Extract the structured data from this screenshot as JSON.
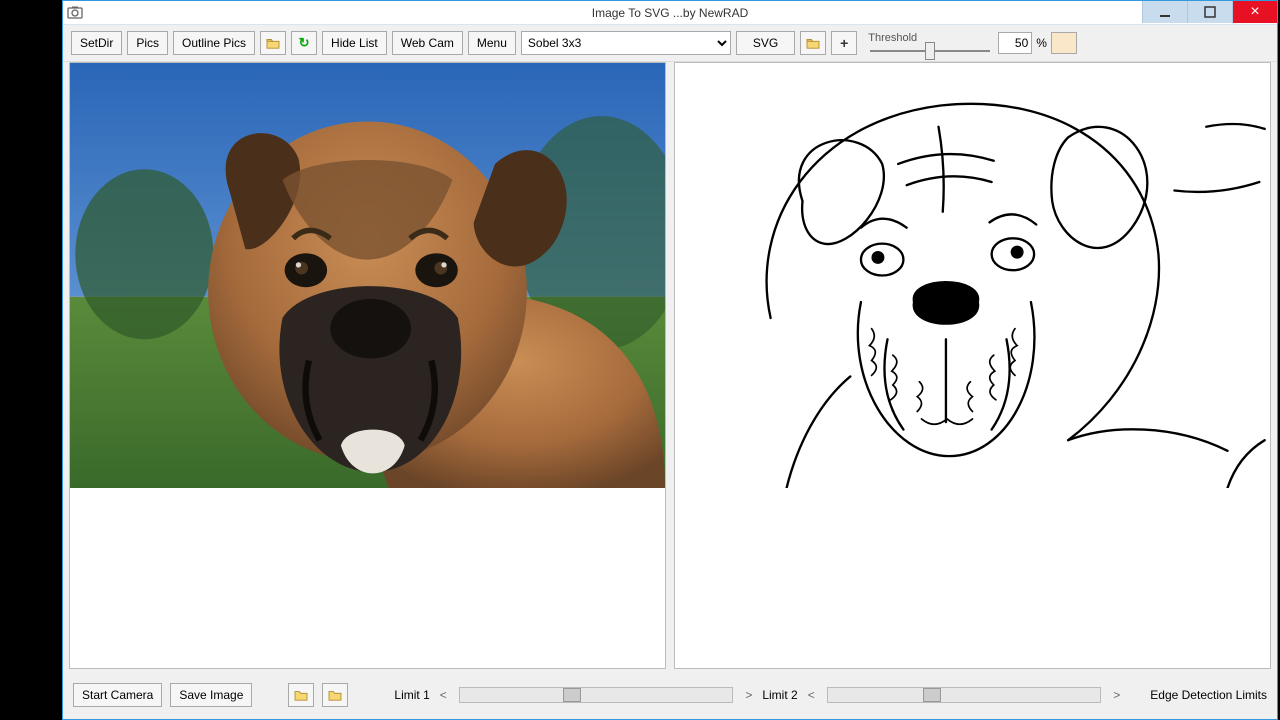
{
  "window": {
    "title": "Image To SVG  ...by NewRAD"
  },
  "toolbar": {
    "setdir": "SetDir",
    "pics": "Pics",
    "outlinepics": "Outline Pics",
    "hidelist": "Hide List",
    "webcam": "Web Cam",
    "menu": "Menu",
    "filter_selected": "Sobel 3x3",
    "svg": "SVG",
    "threshold_label": "Threshold",
    "threshold_value": "50",
    "percent_label": "%"
  },
  "bottom": {
    "startcam": "Start Camera",
    "saveimg": "Save Image",
    "limit1": "Limit 1",
    "limit2": "Limit 2",
    "edge_limits": "Edge Detection Limits",
    "arrow_left": "<",
    "arrow_right": ">"
  }
}
